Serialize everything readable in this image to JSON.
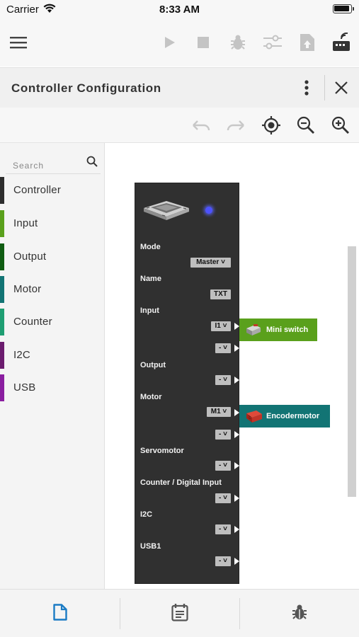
{
  "status_bar": {
    "carrier": "Carrier",
    "time": "8:33 AM"
  },
  "app_toolbar": {
    "icons": [
      "menu-icon",
      "play-icon",
      "stop-icon",
      "debug-icon",
      "settings-sliders-icon",
      "upload-icon",
      "controller-connect-icon"
    ]
  },
  "panel": {
    "title": "Controller Configuration"
  },
  "canvas_tools": {
    "icons": [
      "undo-icon",
      "redo-icon",
      "center-icon",
      "zoom-out-icon",
      "zoom-in-icon"
    ]
  },
  "sidebar": {
    "search_placeholder": "Search",
    "categories": [
      {
        "label": "Controller",
        "color": "#2d2d2d"
      },
      {
        "label": "Input",
        "color": "#5aa01c"
      },
      {
        "label": "Output",
        "color": "#0f5c12"
      },
      {
        "label": "Motor",
        "color": "#127474"
      },
      {
        "label": "Counter",
        "color": "#1e9e72"
      },
      {
        "label": "I2C",
        "color": "#6b1c6e"
      },
      {
        "label": "USB",
        "color": "#8a1ea0"
      }
    ]
  },
  "controller_block": {
    "led_color": "#4d52ff",
    "mode_label": "Mode",
    "mode_value": "Master ˅",
    "name_label": "Name",
    "name_value": "TXT",
    "input_label": "Input",
    "input_ports": [
      "I1 ˅",
      "- ˅"
    ],
    "output_label": "Output",
    "output_ports": [
      "- ˅"
    ],
    "motor_label": "Motor",
    "motor_ports": [
      "M1 ˅",
      "- ˅"
    ],
    "servomotor_label": "Servomotor",
    "servomotor_ports": [
      "- ˅"
    ],
    "counter_label": "Counter / Digital Input",
    "counter_ports": [
      "- ˅"
    ],
    "i2c_label": "I2C",
    "i2c_ports": [
      "- ˅"
    ],
    "usb_label": "USB1",
    "usb_ports": [
      "- ˅"
    ]
  },
  "attached_devices": [
    {
      "name": "Mini switch",
      "color": "#5aa01c"
    },
    {
      "name": "Encodermotor",
      "color": "#127474"
    }
  ],
  "bottom_tabs": {
    "icons": [
      "document-icon",
      "calendar-icon",
      "debug-icon"
    ],
    "active_color": "#1b7bc4"
  }
}
